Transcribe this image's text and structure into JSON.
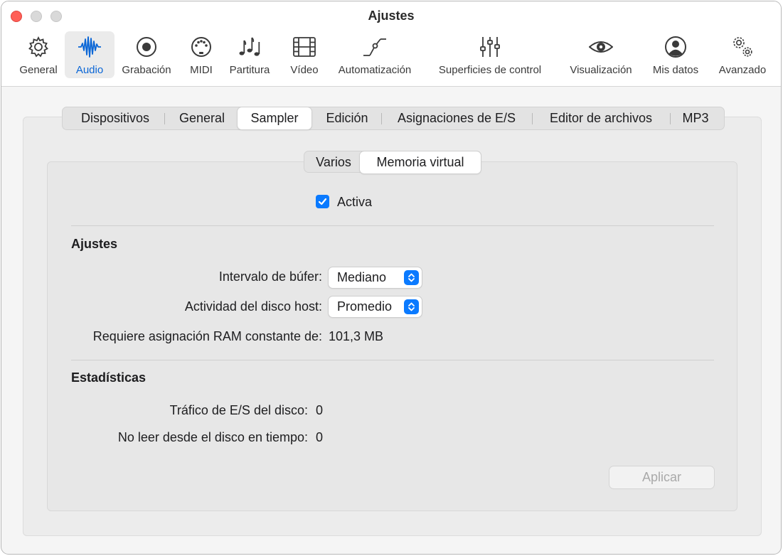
{
  "window": {
    "title": "Ajustes"
  },
  "toolbar": {
    "items": [
      {
        "label": "General",
        "icon": "gear-icon"
      },
      {
        "label": "Audio",
        "icon": "audio-waveform-icon",
        "active": true
      },
      {
        "label": "Grabación",
        "icon": "record-icon"
      },
      {
        "label": "MIDI",
        "icon": "midi-port-icon"
      },
      {
        "label": "Partitura",
        "icon": "music-notes-icon"
      },
      {
        "label": "Vídeo",
        "icon": "film-strip-icon"
      },
      {
        "label": "Automatización",
        "icon": "automation-curve-icon"
      },
      {
        "label": "Superficies de control",
        "icon": "sliders-icon"
      },
      {
        "label": "Visualización",
        "icon": "eye-icon"
      },
      {
        "label": "Mis datos",
        "icon": "person-icon"
      },
      {
        "label": "Avanzado",
        "icon": "gears-icon"
      }
    ]
  },
  "tabs": {
    "items": [
      "Dispositivos",
      "General",
      "Sampler",
      "Edición",
      "Asignaciones de E/S",
      "Editor de archivos",
      "MP3"
    ],
    "selected": "Sampler"
  },
  "subtabs": {
    "items": [
      "Varios",
      "Memoria virtual"
    ],
    "selected": "Memoria virtual"
  },
  "content": {
    "enable_checkbox": {
      "label": "Activa",
      "checked": true
    },
    "settings_heading": "Ajustes",
    "buffer_label": "Intervalo de búfer:",
    "buffer_value": "Mediano",
    "disk_activity_label": "Actividad del disco host:",
    "disk_activity_value": "Promedio",
    "ram_label": "Requiere asignación RAM constante de:",
    "ram_value": "101,3 MB",
    "stats_heading": "Estadísticas",
    "disk_io_label": "Tráfico de E/S del disco:",
    "disk_io_value": "0",
    "not_read_label": "No leer desde el disco en tiempo:",
    "not_read_value": "0",
    "apply_label": "Aplicar"
  },
  "colors": {
    "accent": "#0a7aff",
    "close": "#ff5f57",
    "active_label": "#0a66d6"
  }
}
